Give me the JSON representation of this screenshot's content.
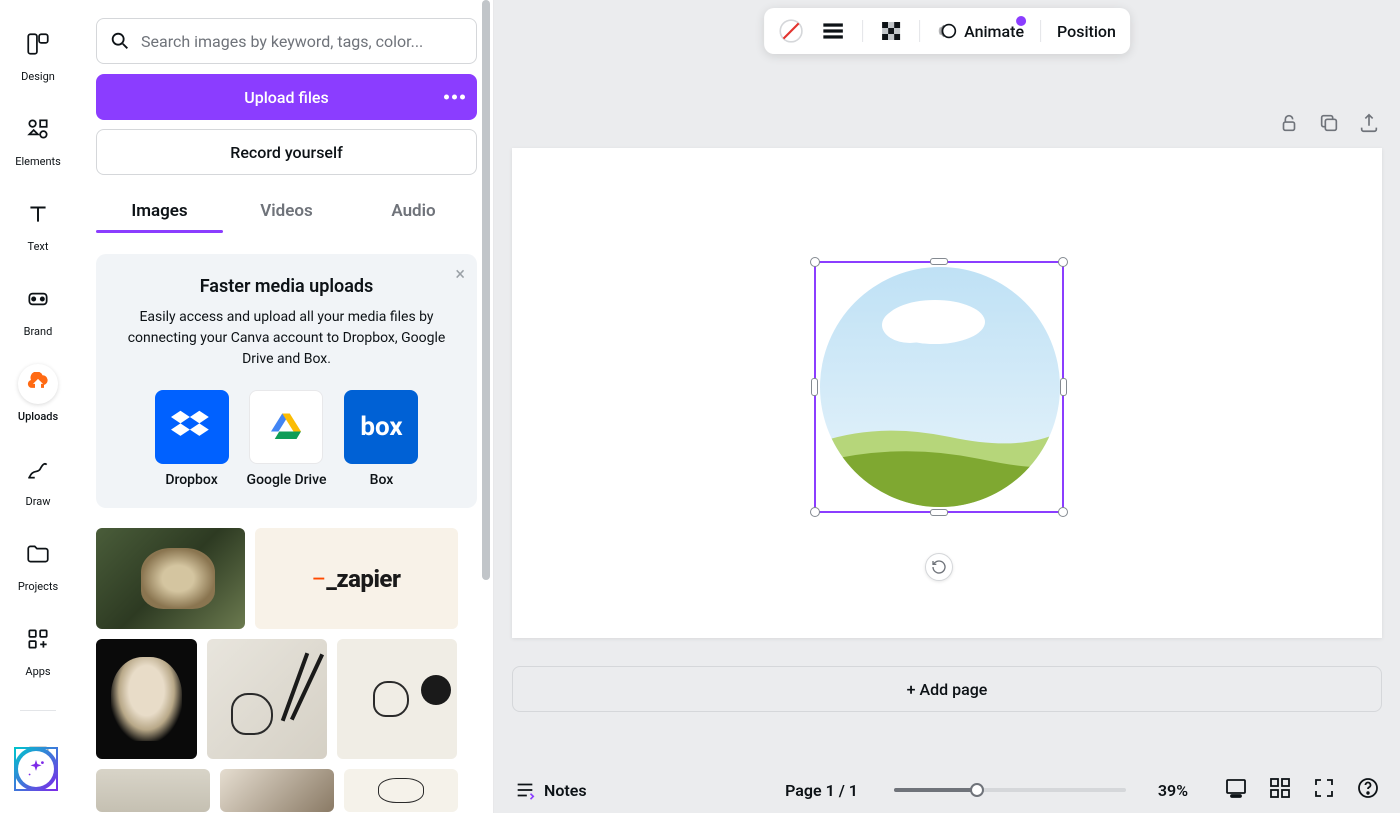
{
  "rail": {
    "items": [
      {
        "label": "Design"
      },
      {
        "label": "Elements"
      },
      {
        "label": "Text"
      },
      {
        "label": "Brand"
      },
      {
        "label": "Uploads"
      },
      {
        "label": "Draw"
      },
      {
        "label": "Projects"
      },
      {
        "label": "Apps"
      }
    ]
  },
  "panel": {
    "search_placeholder": "Search images by keyword, tags, color...",
    "upload_label": "Upload files",
    "record_label": "Record yourself",
    "tabs": [
      {
        "label": "Images"
      },
      {
        "label": "Videos"
      },
      {
        "label": "Audio"
      }
    ],
    "promo": {
      "title": "Faster media uploads",
      "description": "Easily access and upload all your media files by connecting your Canva account to Dropbox, Google Drive and Box.",
      "apps": [
        {
          "label": "Dropbox"
        },
        {
          "label": "Google Drive"
        },
        {
          "label": "Box"
        }
      ]
    },
    "thumb_zapier": "_zapier"
  },
  "toolbar": {
    "animate_label": "Animate",
    "position_label": "Position"
  },
  "canvas": {
    "add_page_label": "+ Add page"
  },
  "bottom": {
    "notes_label": "Notes",
    "page_indicator": "Page 1 / 1",
    "zoom_pct": "39%"
  }
}
